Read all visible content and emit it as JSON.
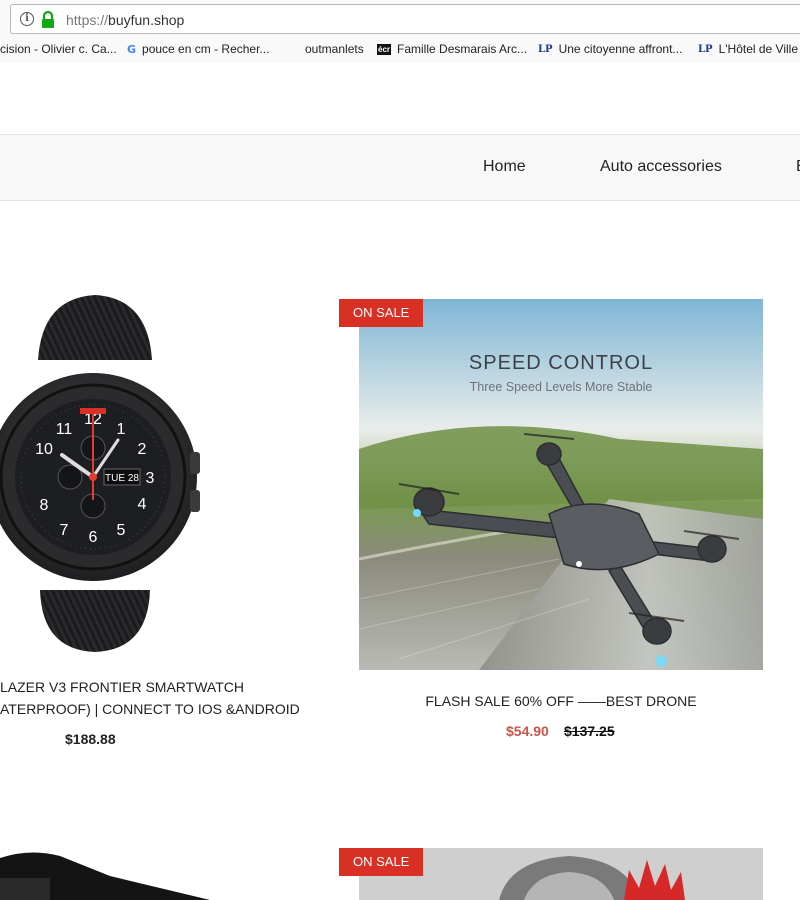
{
  "browser": {
    "url_protocol": "https://",
    "url_domain": "buyfun.shop",
    "bookmarks": [
      {
        "label": "cision - Olivier c. Ca...",
        "icon": "none"
      },
      {
        "label": "pouce en cm - Recher...",
        "icon": "google-icon"
      },
      {
        "label": "outmanlets",
        "icon": "none"
      },
      {
        "label": "Famille Desmarais Arc...",
        "icon": "ecr-icon"
      },
      {
        "label": "Une citoyenne affront...",
        "icon": "lp-icon"
      },
      {
        "label": "L'Hôtel de Ville",
        "icon": "lp-icon"
      }
    ]
  },
  "nav": {
    "items": [
      "Home",
      "Auto accessories",
      "B"
    ]
  },
  "products": [
    {
      "title_line1": "LAZER V3 FRONTIER SMARTWATCH",
      "title_line2": "ATERPROOF) | CONNECT TO IOS &ANDROID",
      "price": "$188.88",
      "image": "smartwatch"
    },
    {
      "badge": "ON SALE",
      "title_line1": "FLASH SALE 60% OFF ——BEST DRONE",
      "sale_price": "$54.90",
      "old_price": "$137.25",
      "image": "drone",
      "image_heading": "SPEED CONTROL",
      "image_subheading": "Three Speed Levels  More Stable"
    },
    {
      "badge": "ON SALE",
      "image": "partial-product"
    }
  ],
  "colors": {
    "badge": "#d93025",
    "sale_price": "#c9544d",
    "nav_bg": "#f8f8f8"
  }
}
